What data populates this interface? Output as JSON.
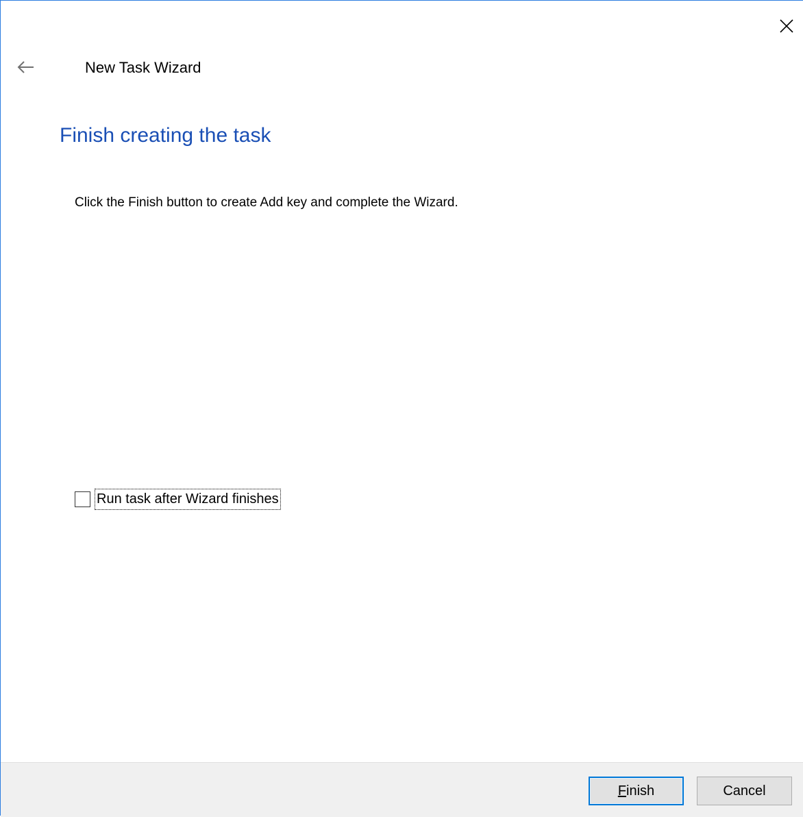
{
  "window": {
    "title": "New Task Wizard"
  },
  "page": {
    "heading": "Finish creating the task",
    "instructions": "Click the Finish button to create Add key and complete the Wizard."
  },
  "run_after": {
    "label": "Run task after Wizard finishes",
    "checked": false
  },
  "buttons": {
    "finish_first": "F",
    "finish_rest": "inish",
    "cancel": "Cancel"
  },
  "icons": {
    "back": "arrow-left-icon",
    "close": "close-icon"
  },
  "colors": {
    "heading": "#1a4fb5",
    "accent_border": "#0078d7",
    "footer_bg": "#f0f0f0"
  }
}
